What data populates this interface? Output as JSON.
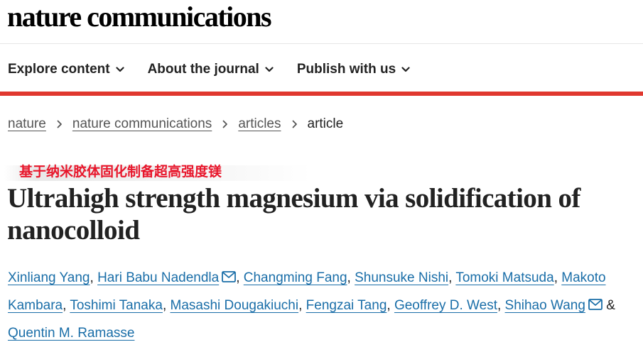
{
  "site": {
    "logo": "nature communications"
  },
  "nav": {
    "items": [
      {
        "label": "Explore content"
      },
      {
        "label": "About the journal"
      },
      {
        "label": "Publish with us"
      }
    ]
  },
  "breadcrumb": {
    "items": [
      "nature",
      "nature communications",
      "articles"
    ],
    "current": "article"
  },
  "overlay": {
    "caption": "基于纳米胶体固化制备超高强度镁"
  },
  "article": {
    "title": "Ultrahigh strength magnesium via solidification of nanocolloid",
    "authors": [
      "Xinliang Yang",
      "Hari Babu Nadendla",
      "Changming Fang",
      "Shunsuke Nishi",
      "Tomoki Matsuda",
      "Makoto Kambara",
      "Toshimi Tanaka",
      "Masashi Dougakiuchi",
      "Fengzai Tang",
      "Geoffrey D. West",
      "Shihao Wang",
      "Quentin M. Ramasse"
    ],
    "author_separator": ",",
    "author_last_joiner": "&"
  },
  "icons": {
    "nav_chevron": "chevron-down-icon",
    "breadcrumb_separator": "chevron-right-icon",
    "corresponding_author": "mail-icon"
  },
  "colors": {
    "brand_red": "#e0382f",
    "link_blue": "#1a6ea8",
    "caption_red": "#e8162b",
    "text": "#222222"
  }
}
